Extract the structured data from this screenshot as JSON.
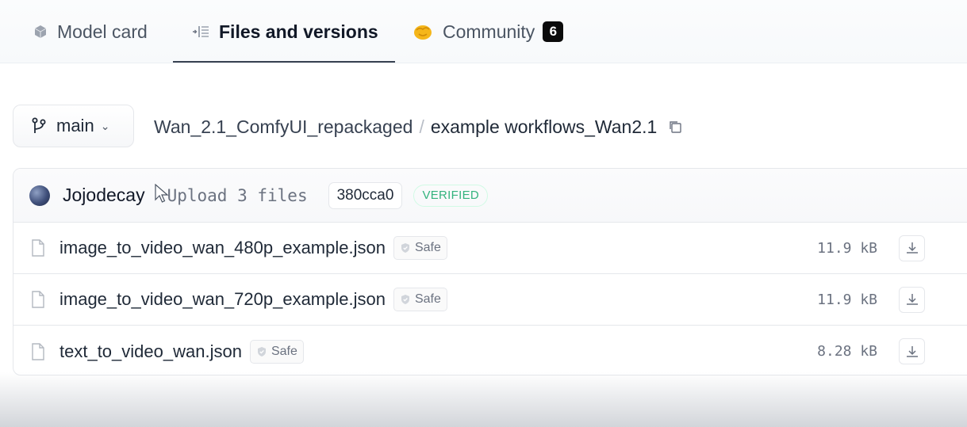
{
  "tabs": {
    "model_card": "Model card",
    "files_versions": "Files and versions",
    "community": "Community",
    "community_count": "6"
  },
  "branch": {
    "name": "main"
  },
  "breadcrumb": {
    "repo": "Wan_2.1_ComfyUI_repackaged",
    "separator": "/",
    "folder": "example workflows_Wan2.1"
  },
  "commit": {
    "author": "Jojodecay",
    "message": "Upload 3 files",
    "sha": "380cca0",
    "verified": "VERIFIED"
  },
  "files": [
    {
      "name": "image_to_video_wan_480p_example.json",
      "badge": "Safe",
      "size": "11.9 kB"
    },
    {
      "name": "image_to_video_wan_720p_example.json",
      "badge": "Safe",
      "size": "11.9 kB"
    },
    {
      "name": "text_to_video_wan.json",
      "badge": "Safe",
      "size": "8.28 kB"
    }
  ],
  "colors": {
    "accent_underline": "#374151",
    "verified_green": "#34b37e",
    "community_icon": "#f5b61a"
  },
  "icons": {
    "model_card": "cube-icon",
    "files": "list-icon",
    "community": "hand-icon",
    "branch": "git-branch-icon",
    "copy": "copy-icon",
    "file": "file-icon",
    "safe": "shield-icon",
    "download": "download-icon"
  }
}
